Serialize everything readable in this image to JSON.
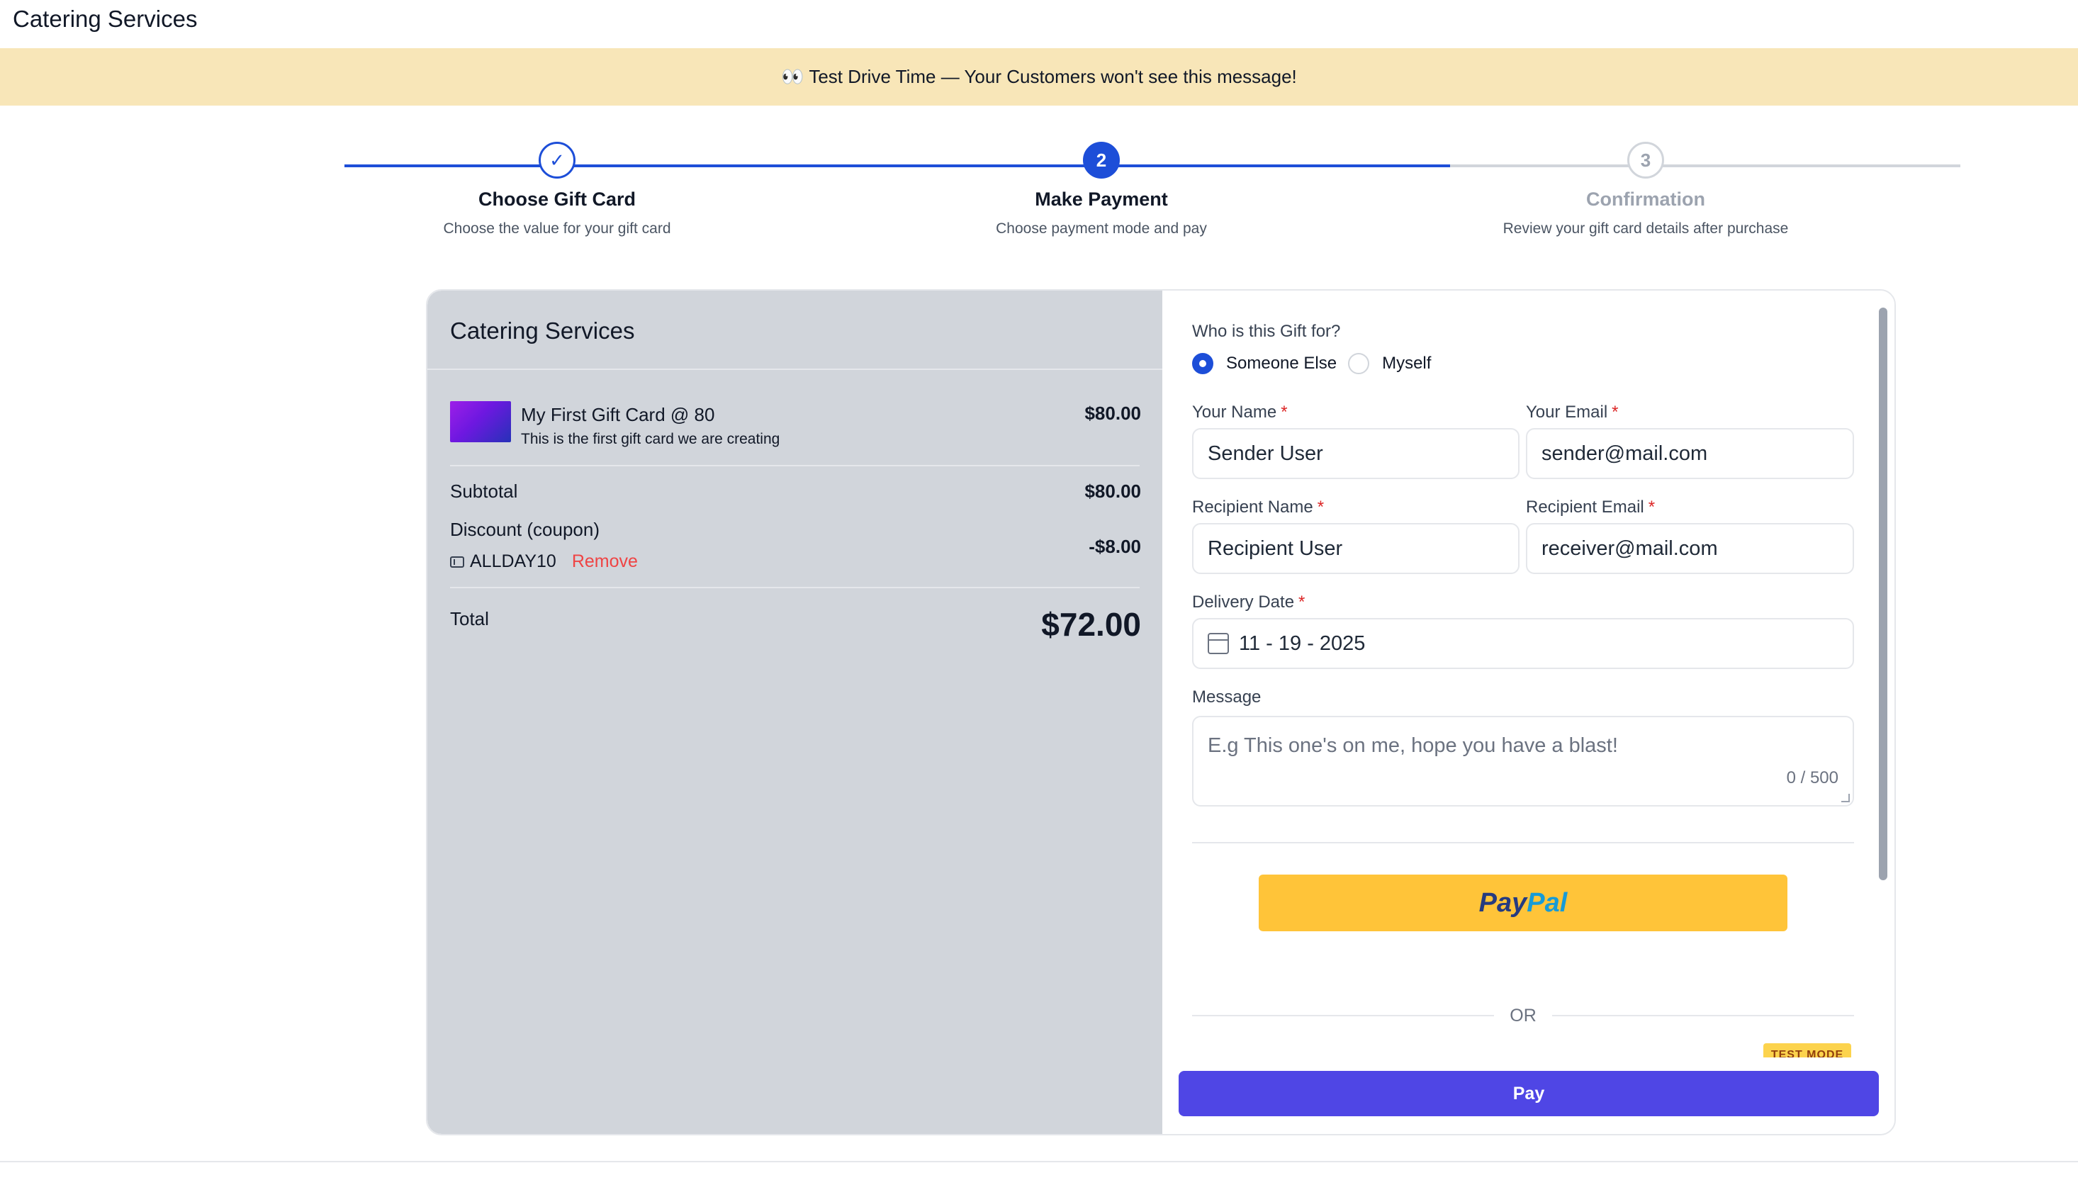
{
  "header": {
    "brand": "Catering Services"
  },
  "banner": {
    "text": "👀 Test Drive Time — Your Customers won't see this message!"
  },
  "stepper": {
    "steps": [
      {
        "number": "✓",
        "title": "Choose Gift Card",
        "subtitle": "Choose the value for your gift card",
        "state": "done"
      },
      {
        "number": "2",
        "title": "Make Payment",
        "subtitle": "Choose payment mode and pay",
        "state": "active"
      },
      {
        "number": "3",
        "title": "Confirmation",
        "subtitle": "Review your gift card details after purchase",
        "state": "todo"
      }
    ]
  },
  "summary": {
    "shop_name": "Catering Services",
    "item": {
      "title": "My First Gift Card @ 80",
      "description": "This is the first gift card we are creating",
      "price": "$80.00"
    },
    "subtotal_label": "Subtotal",
    "subtotal_value": "$80.00",
    "discount_label": "Discount (coupon)",
    "discount_value": "-$8.00",
    "coupon_code": "ALLDAY10",
    "remove_label": "Remove",
    "total_label": "Total",
    "total_value": "$72.00"
  },
  "form": {
    "gift_for_label": "Who is this Gift for?",
    "options": [
      "Someone Else",
      "Myself"
    ],
    "selected_option": "Someone Else",
    "your_name_label": "Your Name",
    "your_name_value": "Sender User",
    "your_email_label": "Your Email",
    "your_email_value": "sender@mail.com",
    "recipient_name_label": "Recipient Name",
    "recipient_name_value": "Recipient User",
    "recipient_email_label": "Recipient Email",
    "recipient_email_value": "receiver@mail.com",
    "delivery_date_label": "Delivery Date",
    "delivery_date_value": "11 - 19 - 2025",
    "message_label": "Message",
    "message_placeholder": "E.g This one's on me, hope you have a blast!",
    "message_count": "0 / 500",
    "required_mark": "*"
  },
  "payment": {
    "paypal_part1": "Pay",
    "paypal_part2": "Pal",
    "or_label": "OR",
    "test_mode_badge": "TEST MODE",
    "pay_label": "Pay"
  },
  "colors": {
    "accent": "#1d4ed8",
    "pay_button": "#4f46e5",
    "paypal": "#ffc439",
    "banner": "#f8e6b8",
    "required": "#dc2626",
    "remove": "#ef4444"
  }
}
